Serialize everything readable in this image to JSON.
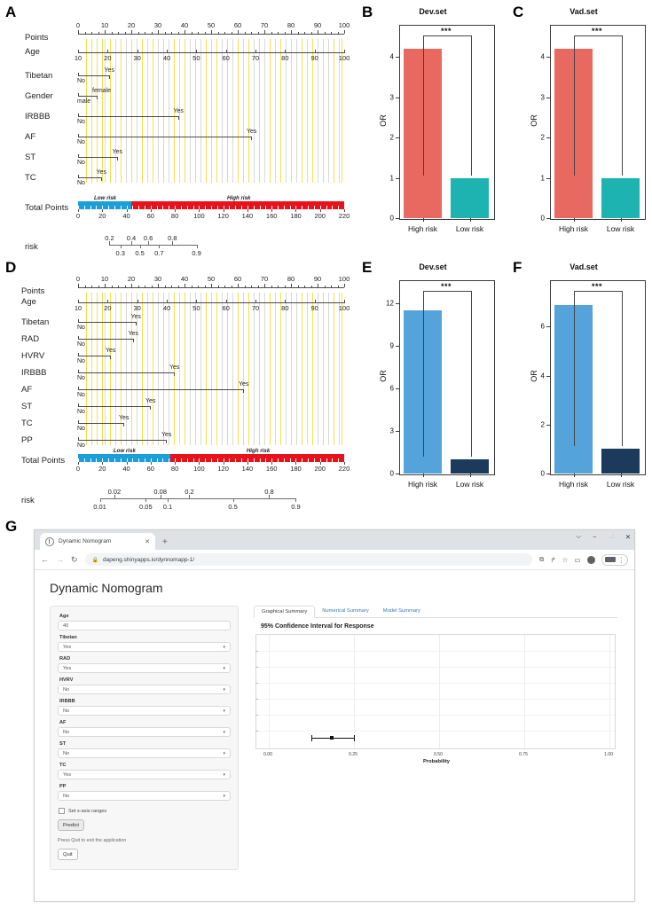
{
  "figure": {
    "panels": [
      "A",
      "B",
      "C",
      "D",
      "E",
      "F",
      "G"
    ]
  },
  "nomogram_a": {
    "rows": [
      {
        "label": "Points"
      },
      {
        "label": "Age"
      },
      {
        "label": "Tibetan"
      },
      {
        "label": "Gender"
      },
      {
        "label": "IRBBB"
      },
      {
        "label": "AF"
      },
      {
        "label": "ST"
      },
      {
        "label": "TC"
      },
      {
        "label": "Total Points"
      },
      {
        "label": "risk"
      }
    ],
    "points_axis": {
      "ticks": [
        0,
        10,
        20,
        30,
        40,
        50,
        60,
        70,
        80,
        90,
        100
      ]
    },
    "age_axis": {
      "ticks": [
        10,
        20,
        30,
        40,
        50,
        60,
        70,
        80,
        90,
        100
      ]
    },
    "predictors": [
      {
        "name": "Tibetan",
        "low_label": "No",
        "high_label": "Yes",
        "low_points": 0,
        "high_points": 11.5
      },
      {
        "name": "Gender",
        "low_label": "male",
        "high_label": "female",
        "low_points": 0,
        "high_points": 7.0
      },
      {
        "name": "IRBBB",
        "low_label": "No",
        "high_label": "Yes",
        "low_points": 0,
        "high_points": 37.5
      },
      {
        "name": "AF",
        "low_label": "No",
        "high_label": "Yes",
        "low_points": 0,
        "high_points": 65.0
      },
      {
        "name": "ST",
        "low_label": "No",
        "high_label": "Yes",
        "low_points": 0,
        "high_points": 14.5
      },
      {
        "name": "TC",
        "low_label": "No",
        "high_label": "Yes",
        "low_points": 0,
        "high_points": 8.5
      }
    ],
    "total_points_axis": {
      "ticks": [
        0,
        20,
        40,
        60,
        80,
        100,
        120,
        140,
        160,
        180,
        200,
        220
      ],
      "max": 220
    },
    "risk_band": {
      "low_label": "Low risk",
      "high_label": "High risk",
      "cutoff": 44
    },
    "risk_axis": {
      "upper_ticks": [
        {
          "label": "0.2",
          "points": 26
        },
        {
          "label": "0.4",
          "points": 44
        },
        {
          "label": "0.6",
          "points": 58
        },
        {
          "label": "0.8",
          "points": 78
        }
      ],
      "lower_ticks": [
        {
          "label": "0.3",
          "points": 35
        },
        {
          "label": "0.5",
          "points": 51
        },
        {
          "label": "0.7",
          "points": 67
        },
        {
          "label": "0.9",
          "points": 98
        }
      ]
    }
  },
  "nomogram_d": {
    "rows": [
      {
        "label": "Points"
      },
      {
        "label": "Age"
      },
      {
        "label": "Tibetan"
      },
      {
        "label": "RAD"
      },
      {
        "label": "HVRV"
      },
      {
        "label": "IRBBB"
      },
      {
        "label": "AF"
      },
      {
        "label": "ST"
      },
      {
        "label": "TC"
      },
      {
        "label": "PP"
      },
      {
        "label": "Total Points"
      },
      {
        "label": "risk"
      }
    ],
    "points_axis": {
      "ticks": [
        0,
        10,
        20,
        30,
        40,
        50,
        60,
        70,
        80,
        90,
        100
      ]
    },
    "age_axis": {
      "ticks": [
        10,
        20,
        30,
        40,
        50,
        60,
        70,
        80,
        90,
        100
      ]
    },
    "predictors": [
      {
        "name": "Tibetan",
        "low_label": "No",
        "high_label": "Yes",
        "low_points": 0,
        "high_points": 21.5
      },
      {
        "name": "RAD",
        "low_label": "No",
        "high_label": "Yes",
        "low_points": 0,
        "high_points": 20.5
      },
      {
        "name": "HVRV",
        "low_label": "No",
        "high_label": "Yes",
        "low_points": 0,
        "high_points": 12.0
      },
      {
        "name": "IRBBB",
        "low_label": "No",
        "high_label": "Yes",
        "low_points": 0,
        "high_points": 36.0
      },
      {
        "name": "AF",
        "low_label": "No",
        "high_label": "Yes",
        "low_points": 0,
        "high_points": 62.0
      },
      {
        "name": "ST",
        "low_label": "No",
        "high_label": "Yes",
        "low_points": 0,
        "high_points": 27.0
      },
      {
        "name": "TC",
        "low_label": "No",
        "high_label": "Yes",
        "low_points": 0,
        "high_points": 17.0
      },
      {
        "name": "PP",
        "low_label": "No",
        "high_label": "Yes",
        "low_points": 0,
        "high_points": 33.0
      }
    ],
    "total_points_axis": {
      "ticks": [
        0,
        20,
        40,
        60,
        80,
        100,
        120,
        140,
        160,
        180,
        200,
        220
      ],
      "max": 220
    },
    "risk_band": {
      "low_label": "Low risk",
      "high_label": "High risk",
      "cutoff": 76
    },
    "risk_axis": {
      "upper_ticks": [
        {
          "label": "0.02",
          "points": 30
        },
        {
          "label": "0.08",
          "points": 68
        },
        {
          "label": "0.2",
          "points": 92
        },
        {
          "label": "0.8",
          "points": 158
        }
      ],
      "lower_ticks": [
        {
          "label": "0.01",
          "points": 18
        },
        {
          "label": "0.05",
          "points": 56
        },
        {
          "label": "0.1",
          "points": 74
        },
        {
          "label": "0.5",
          "points": 128
        },
        {
          "label": "0.9",
          "points": 180
        }
      ]
    }
  },
  "chart_data": [
    {
      "panel": "B",
      "type": "bar",
      "title": "Dev.set",
      "xlabel": "",
      "ylabel": "OR",
      "categories": [
        "High risk",
        "Low risk"
      ],
      "values": [
        4.2,
        1.0
      ],
      "colors": [
        "#E8695F",
        "#1CB3B0"
      ],
      "ylim": [
        0,
        4.8
      ],
      "yticks": [
        0,
        1,
        2,
        3,
        4
      ],
      "annotation": "***",
      "grid": false,
      "legend": "none"
    },
    {
      "panel": "C",
      "type": "bar",
      "title": "Vad.set",
      "xlabel": "",
      "ylabel": "OR",
      "categories": [
        "High risk",
        "Low risk"
      ],
      "values": [
        4.2,
        1.0
      ],
      "colors": [
        "#E8695F",
        "#1CB3B0"
      ],
      "ylim": [
        0,
        4.8
      ],
      "yticks": [
        0,
        1,
        2,
        3,
        4
      ],
      "annotation": "***",
      "grid": false,
      "legend": "none"
    },
    {
      "panel": "E",
      "type": "bar",
      "title": "Dev.set",
      "xlabel": "",
      "ylabel": "OR",
      "categories": [
        "High risk",
        "Low risk"
      ],
      "values": [
        11.5,
        1.0
      ],
      "colors": [
        "#55A3DB",
        "#1B3A5C"
      ],
      "ylim": [
        0,
        13.6
      ],
      "yticks": [
        0,
        3,
        6,
        9,
        12
      ],
      "annotation": "***",
      "grid": false,
      "legend": "none"
    },
    {
      "panel": "F",
      "type": "bar",
      "title": "Vad.set",
      "xlabel": "",
      "ylabel": "OR",
      "categories": [
        "High risk",
        "Low risk"
      ],
      "values": [
        6.9,
        1.0
      ],
      "colors": [
        "#55A3DB",
        "#1B3A5C"
      ],
      "ylim": [
        0,
        7.9
      ],
      "yticks": [
        0,
        2,
        4,
        6
      ],
      "annotation": "***",
      "grid": false,
      "legend": "none"
    },
    {
      "panel": "G-plot",
      "type": "scatter",
      "title": "95% Confidence Interval for Response",
      "xlabel": "Probability",
      "ylabel": "",
      "xticks": [
        "0.00",
        "0.25",
        "0.50",
        "0.75",
        "1.00"
      ],
      "xlim": [
        0,
        1
      ],
      "point": 0.185,
      "ci_low": 0.125,
      "ci_high": 0.25,
      "grid": true,
      "legend": "none"
    }
  ],
  "browser": {
    "tab": {
      "title": "Dynamic Nomogram",
      "close": "✕"
    },
    "new_tab": "+",
    "window_controls": {
      "chevron": "⌵",
      "minimize": "−",
      "maximize": "⬜",
      "close": "✕"
    },
    "nav": {
      "back": "←",
      "forward": "→",
      "reload": "↻"
    },
    "omnibox": {
      "lock": "🔒",
      "url": "dapeng.shinyapps.io/dynnomapp-1/"
    },
    "actions": {
      "extensions": "⧉",
      "share": "↱",
      "bookmark": "☆",
      "sidepanel": "▭",
      "profile": "●",
      "menu": "⋮"
    }
  },
  "app": {
    "title": "Dynamic Nomogram",
    "form": {
      "fields": [
        {
          "label": "Age",
          "value": "40",
          "type": "text"
        },
        {
          "label": "Tibetan",
          "value": "Yes",
          "type": "select"
        },
        {
          "label": "RAD",
          "value": "Yes",
          "type": "select"
        },
        {
          "label": "HVRV",
          "value": "No",
          "type": "select"
        },
        {
          "label": "IRBBB",
          "value": "No",
          "type": "select"
        },
        {
          "label": "AF",
          "value": "No",
          "type": "select"
        },
        {
          "label": "ST",
          "value": "No",
          "type": "select"
        },
        {
          "label": "TC",
          "value": "Yes",
          "type": "select"
        },
        {
          "label": "PP",
          "value": "No",
          "type": "select"
        }
      ],
      "checkbox_label": "Set x-axis ranges",
      "predict_button": "Predict",
      "quit_hint": "Press Quit to exit the application",
      "quit_button": "Quit"
    },
    "tabs": [
      {
        "label": "Graphical Summary",
        "active": true
      },
      {
        "label": "Numerical Summary",
        "active": false
      },
      {
        "label": "Model Summary",
        "active": false
      }
    ],
    "plot": {
      "title": "95% Confidence Interval for Response",
      "xaxis_title": "Probability",
      "xticks": [
        "0.00",
        "0.25",
        "0.50",
        "0.75",
        "1.00"
      ]
    }
  },
  "colors": {
    "salmon": "#E8695F",
    "teal": "#1CB3B0",
    "blue": "#55A3DB",
    "navy": "#1B3A5C",
    "low_risk_bar": "#1B9FD8",
    "high_risk_bar": "#E8121C",
    "nomogram_guide": "#F2E14C"
  }
}
